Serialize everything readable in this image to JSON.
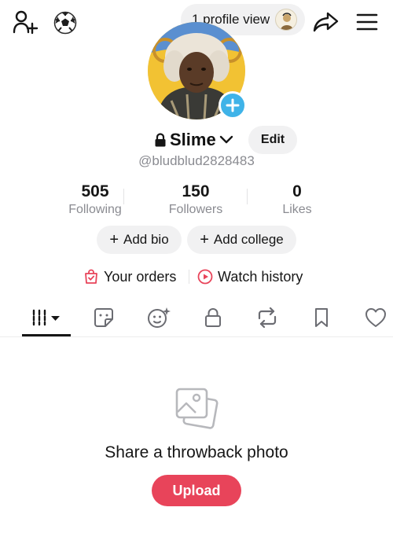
{
  "header": {
    "profile_views_label": "1 profile view"
  },
  "profile": {
    "display_name": "Slime",
    "edit_label": "Edit",
    "handle": "@bludblud2828483"
  },
  "stats": [
    {
      "value": "505",
      "label": "Following"
    },
    {
      "value": "150",
      "label": "Followers"
    },
    {
      "value": "0",
      "label": "Likes"
    }
  ],
  "actions": {
    "add_bio": "Add bio",
    "add_college": "Add college",
    "plus_glyph": "+"
  },
  "links": {
    "orders": "Your orders",
    "watch_history": "Watch history"
  },
  "tabs": [
    {
      "icon": "grid-icon",
      "active": true
    },
    {
      "icon": "sticker-icon"
    },
    {
      "icon": "sparkle-face-icon"
    },
    {
      "icon": "lock-icon"
    },
    {
      "icon": "repost-icon"
    },
    {
      "icon": "bookmark-icon"
    },
    {
      "icon": "heart-icon"
    }
  ],
  "empty_state": {
    "title": "Share a throwback photo",
    "upload_label": "Upload"
  },
  "colors": {
    "accent": "#e8445a",
    "badge_blue": "#3fb3e8",
    "muted_text": "#8a8b91",
    "pill_bg": "#f1f1f2"
  }
}
